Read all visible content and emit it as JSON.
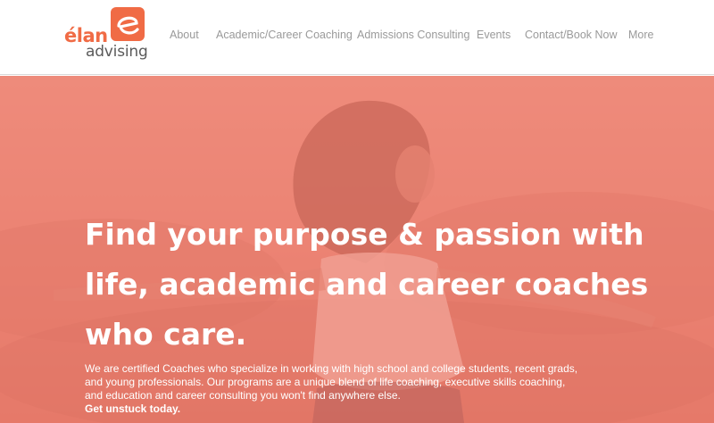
{
  "brand": {
    "word_top": "élan",
    "badge_letter": "e",
    "word_bottom": "advising",
    "accent_color": "#f06b45"
  },
  "nav": {
    "items": [
      {
        "label": "About"
      },
      {
        "label": "Academic/Career Coaching"
      },
      {
        "label": "Admissions Consulting"
      },
      {
        "label": "Events"
      },
      {
        "label": "Contact/Book Now"
      },
      {
        "label": "More"
      }
    ]
  },
  "hero": {
    "headline": "Find your purpose & passion with life, academic and career coaches who care.",
    "body": "We are certified Coaches who specialize in working with high school and college students, recent grads, and young professionals. Our programs are a unique blend of life coaching, executive skills coaching, and education and career consulting you won't find anywhere else.",
    "cta": "Get unstuck today.",
    "overlay_color": "#ee7c6c"
  }
}
